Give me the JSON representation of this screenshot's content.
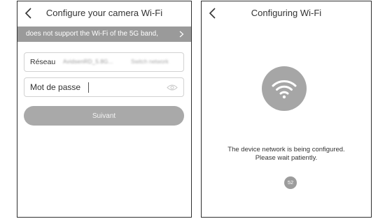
{
  "left_screen": {
    "title": "Configure your camera Wi-Fi",
    "banner_text": "does not support the Wi-Fi of the 5G band,",
    "network_field": {
      "label": "Réseau",
      "ssid": "AvidsenRD_5.8G...",
      "switch_link": "Switch network"
    },
    "password_field": {
      "label": "Mot de passe",
      "value": ""
    },
    "next_button": "Suivant"
  },
  "right_screen": {
    "title": "Configuring Wi-Fi",
    "message_line1": "The device network is being configured.",
    "message_line2": "Please wait patiently.",
    "countdown": "52"
  },
  "icons": {
    "back": "chevron-left-icon",
    "banner_arrow": "chevron-right-icon",
    "password_visibility": "eye-icon",
    "wifi": "wifi-icon"
  },
  "colors": {
    "banner_bg": "#9a9a9a",
    "button_bg": "#a9a9a9",
    "wifi_circle": "#a6a6a6",
    "counter_bg": "#9c9c9c"
  }
}
